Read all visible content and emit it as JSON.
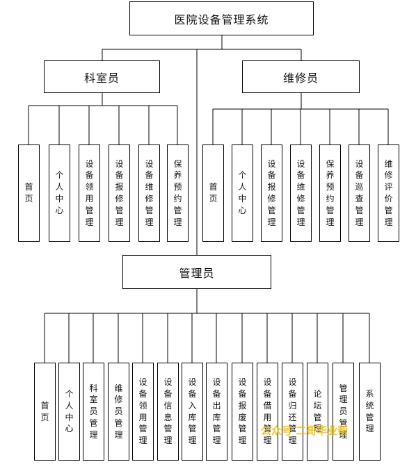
{
  "root": {
    "label": "医院设备管理系统"
  },
  "groups": [
    {
      "label": "科室员",
      "items": [
        "首页",
        "个人中心",
        "设备领用管理",
        "设备报修管理",
        "设备维修管理",
        "保养预约管理"
      ]
    },
    {
      "label": "维修员",
      "items": [
        "首页",
        "个人中心",
        "设备报修管理",
        "设备维修管理",
        "保养预约管理",
        "设备巡查管理",
        "维修评价管理"
      ]
    },
    {
      "label": "管理员",
      "items": [
        "首页",
        "个人中心",
        "科室员管理",
        "维修员管理",
        "设备领用管理",
        "设备信息管理",
        "设备入库管理",
        "设备出库管理",
        "设备报废管理",
        "设备借用管理",
        "设备归还管理",
        "论坛管理",
        "管理员管理",
        "系统管理"
      ]
    }
  ],
  "watermark": "公众号 二哥毕业帮"
}
